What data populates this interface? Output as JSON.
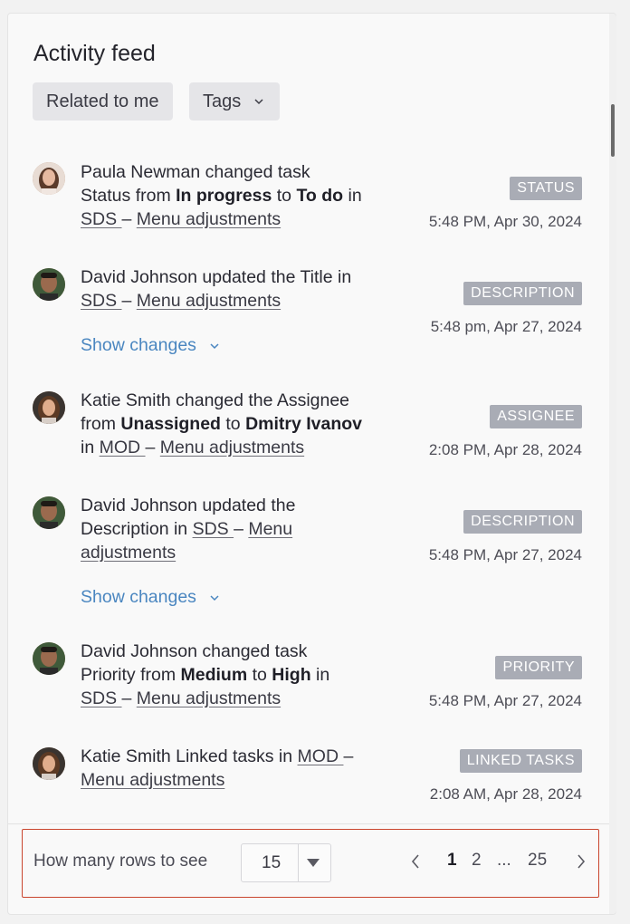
{
  "title": "Activity feed",
  "filters": {
    "related": "Related to me",
    "tags": "Tags"
  },
  "items": [
    {
      "user": "Paula Newman",
      "line1": "Paula Newman changed task",
      "pre": "Status from ",
      "from": "In progress",
      "mid": " to ",
      "to": "To do",
      "post": " in",
      "proj": "SDS ",
      "dash": "– ",
      "task": "Menu adjustments",
      "tag": "STATUS",
      "time": "5:48 PM, Apr 30, 2024"
    },
    {
      "user": "David Johnson",
      "line1": "David Johnson updated the Title in",
      "proj": "SDS ",
      "dash": "– ",
      "task": "Menu adjustments",
      "tag": "DESCRIPTION",
      "time": "5:48 pm, Apr 27, 2024",
      "show": "Show changes"
    },
    {
      "user": "Katie Smith",
      "line1": "Katie Smith changed the Assignee",
      "pre": "from ",
      "from": "Unassigned",
      "mid": " to ",
      "to": "Dmitry Ivanov",
      "lead": "in ",
      "proj": "MOD ",
      "dash": "– ",
      "task": "Menu adjustments",
      "tag": "ASSIGNEE",
      "time": "2:08 PM, Apr 28, 2024"
    },
    {
      "user": "David Johnson",
      "line1": "David Johnson updated the",
      "pre": "Description in ",
      "proj": "SDS ",
      "dash": "– ",
      "task1": "Menu",
      "task2": "adjustments",
      "tag": "DESCRIPTION",
      "time": "5:48 PM, Apr 27, 2024",
      "show": "Show changes"
    },
    {
      "user": "David Johnson",
      "line1": "David Johnson changed task",
      "pre": "Priority from ",
      "from": "Medium",
      "mid": " to ",
      "to": "High",
      "post": " in",
      "proj": "SDS ",
      "dash": "– ",
      "task": "Menu adjustments",
      "tag": "PRIORITY",
      "time": "5:48 PM, Apr 27, 2024"
    },
    {
      "user": "Katie Smith",
      "line1": "Katie Smith Linked tasks in ",
      "proj": "MOD ",
      "dash": "–",
      "task": "Menu adjustments",
      "tag": "LINKED TASKS",
      "time": "2:08 AM, Apr 28, 2024"
    }
  ],
  "footer": {
    "rows_label": "How many rows to see",
    "rows_value": "15",
    "pages": [
      "1",
      "2",
      "...",
      "25"
    ],
    "current_page": "1"
  },
  "icons": {
    "chevron": "chevron-down-icon",
    "prev": "chevron-left-icon",
    "next": "chevron-right-icon",
    "caret": "caret-down-icon"
  },
  "colors": {
    "accent_link": "#4a86c0",
    "tag_bg": "#a9acb5",
    "highlight_border": "#c9452e"
  }
}
